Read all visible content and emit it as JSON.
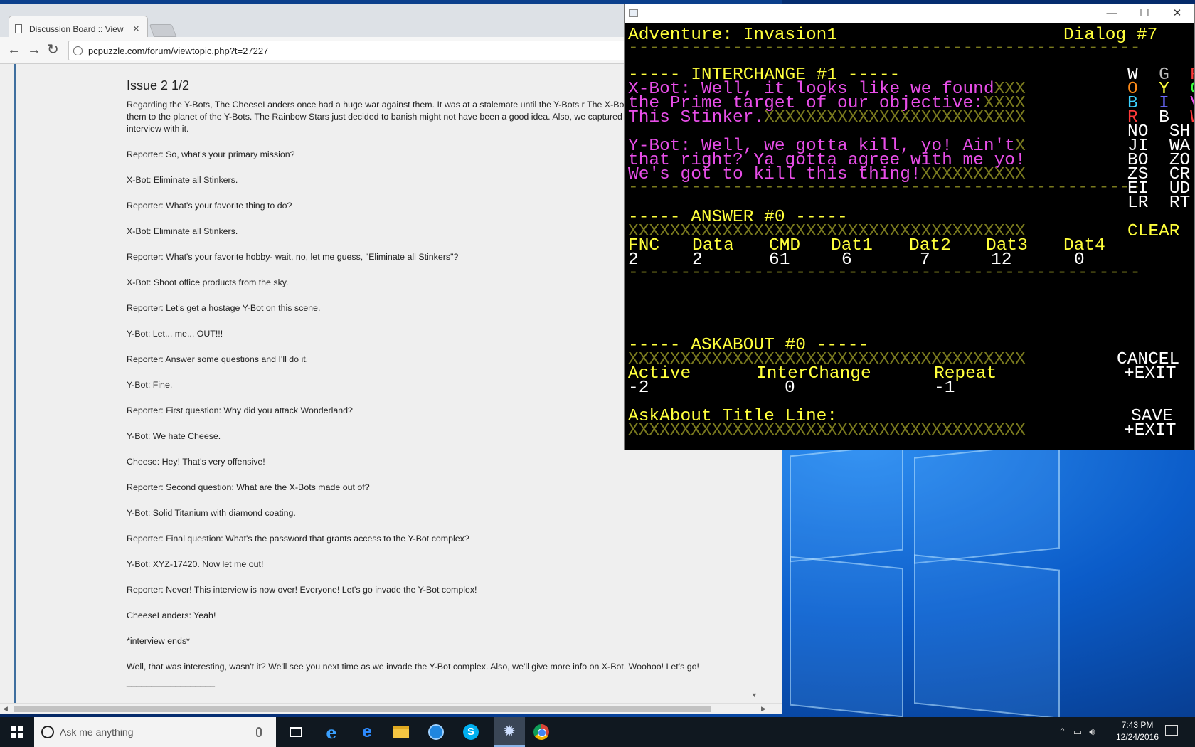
{
  "browser": {
    "tab_title": "Discussion Board :: View",
    "tab_close": "×",
    "url": "pcpuzzle.com/forum/viewtopic.php?t=27227",
    "post": {
      "title": "Issue 2 1/2",
      "intro": "Regarding the Y-Bots, The CheeseLanders once had a huge war against them. It was at a stalemate until the Y-Bots r The X-Bots were unstoppable, so we Exiled them to the planet of the Y-Bots. The Rainbow Stars just decided to banish might not have been a good idea. Also, we captured one of the X-Bot tanks. Here's an interview with it.",
      "lines": [
        "Reporter: So, what's your primary mission?",
        "X-Bot: Eliminate all Stinkers.",
        "Reporter: What's your favorite thing to do?",
        "X-Bot: Eliminate all Stinkers.",
        "Reporter: What's your favorite hobby- wait, no, let me guess, \"Eliminate all Stinkers\"?",
        "X-Bot: Shoot office products from the sky.",
        "Reporter: Let's get a hostage Y-Bot on this scene.",
        "Y-Bot: Let... me... OUT!!!",
        "Reporter: Answer some questions and I'll do it.",
        "Y-Bot: Fine.",
        "Reporter: First question: Why did you attack Wonderland?",
        "Y-Bot: We hate Cheese.",
        "Cheese: Hey! That's very offensive!",
        "Reporter: Second question: What are the X-Bots made out of?",
        "Y-Bot: Solid Titanium with diamond coating.",
        "Reporter: Final question: What's the password that grants access to the Y-Bot complex?",
        "Y-Bot: XYZ-17420. Now let me out!",
        "Reporter: Never! This interview is now over! Everyone! Let's go invade the Y-Bot complex!",
        "CheeseLanders: Yeah!",
        "*interview ends*",
        "Well, that was interesting, wasn't it? We'll see you next time as we invade the Y-Bot complex. Also, we'll give more info on X-Bot. Woohoo! Let's go!"
      ],
      "signature": "__________________"
    }
  },
  "app": {
    "header_left": "Adventure: Invasion1",
    "header_right": "Dialog #7",
    "dash_line": "-------------------------------------------------",
    "interchange_heading": "----- INTERCHANGE #1 -----",
    "text_lines": [
      {
        "text": "X-Bot: Well, it looks like we found",
        "fill": "XXX"
      },
      {
        "text": "the Prime target of our objective:",
        "fill": "XXXX"
      },
      {
        "text": "This Stinker.",
        "fill": "XXXXXXXXXXXXXXXXXXXXXXXXX"
      },
      {
        "text": "Y-Bot: Well, we gotta kill, yo! Ain't",
        "fill": "X"
      },
      {
        "text": "that right? Ya gotta agree with me yo!",
        "fill": ""
      },
      {
        "text": "We's got to kill this thing!",
        "fill": "XXXXXXXXXX"
      }
    ],
    "answer_heading": "----- ANSWER #0 -----",
    "x_line": "XXXXXXXXXXXXXXXXXXXXXXXXXXXXXXXXXXXXXX",
    "answer_cols": [
      "FNC",
      "Data",
      "CMD",
      "Dat1",
      "Dat2",
      "Dat3",
      "Dat4"
    ],
    "answer_vals": [
      "2",
      "2",
      "61",
      "6",
      "7",
      "12",
      "0"
    ],
    "askabout_heading": "----- ASKABOUT #0 -----",
    "ask_cols": [
      "Active",
      "InterChange",
      "Repeat"
    ],
    "ask_vals": [
      "-2",
      "0",
      "-1"
    ],
    "title_line_label": "AskAbout Title Line:",
    "controls": {
      "colors": [
        [
          {
            "t": "W",
            "c": "#ffffff"
          },
          {
            "t": "G",
            "c": "#bdbdbd"
          },
          {
            "t": "R",
            "c": "#ff3a3a"
          }
        ],
        [
          {
            "t": "O",
            "c": "#ff8c1a"
          },
          {
            "t": "Y",
            "c": "#ffff3c"
          },
          {
            "t": "G",
            "c": "#3cff3c"
          }
        ],
        [
          {
            "t": "B",
            "c": "#3cd2ff"
          },
          {
            "t": "I",
            "c": "#6a6aff"
          },
          {
            "t": "V",
            "c": "#e84ee8"
          }
        ],
        [
          {
            "t": "R",
            "c": "#ff3a3a"
          },
          {
            "t": "B",
            "c": "#ffffff"
          },
          {
            "t": "W",
            "c": "#ff3a3a"
          }
        ]
      ],
      "effects": [
        [
          "NO",
          "SH"
        ],
        [
          "JI",
          "WA"
        ],
        [
          "BO",
          "ZO"
        ],
        [
          "ZS",
          "CR"
        ],
        [
          "EI",
          "UD"
        ],
        [
          "LR",
          "RT"
        ]
      ],
      "clear": "CLEAR",
      "cancel": "CANCEL",
      "cancel_exit": "+EXIT",
      "save": "SAVE",
      "save_exit": "+EXIT"
    }
  },
  "taskbar": {
    "search_placeholder": "Ask me anything",
    "time": "7:43 PM",
    "date": "12/24/2016"
  }
}
